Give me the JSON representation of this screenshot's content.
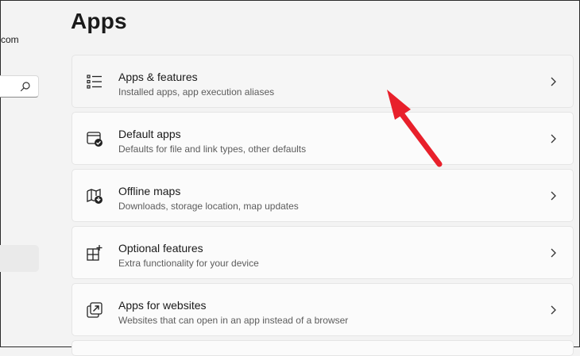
{
  "sidebar": {
    "account_email": "com"
  },
  "page": {
    "title": "Apps"
  },
  "items": [
    {
      "title": "Apps & features",
      "description": "Installed apps, app execution aliases",
      "icon": "apps-features-icon"
    },
    {
      "title": "Default apps",
      "description": "Defaults for file and link types, other defaults",
      "icon": "default-apps-icon"
    },
    {
      "title": "Offline maps",
      "description": "Downloads, storage location, map updates",
      "icon": "offline-maps-icon"
    },
    {
      "title": "Optional features",
      "description": "Extra functionality for your device",
      "icon": "optional-features-icon"
    },
    {
      "title": "Apps for websites",
      "description": "Websites that can open in an app instead of a browser",
      "icon": "apps-for-websites-icon"
    }
  ],
  "colors": {
    "background": "#f3f3f3",
    "card": "#fbfbfb",
    "annotation_arrow": "#e8202b"
  }
}
